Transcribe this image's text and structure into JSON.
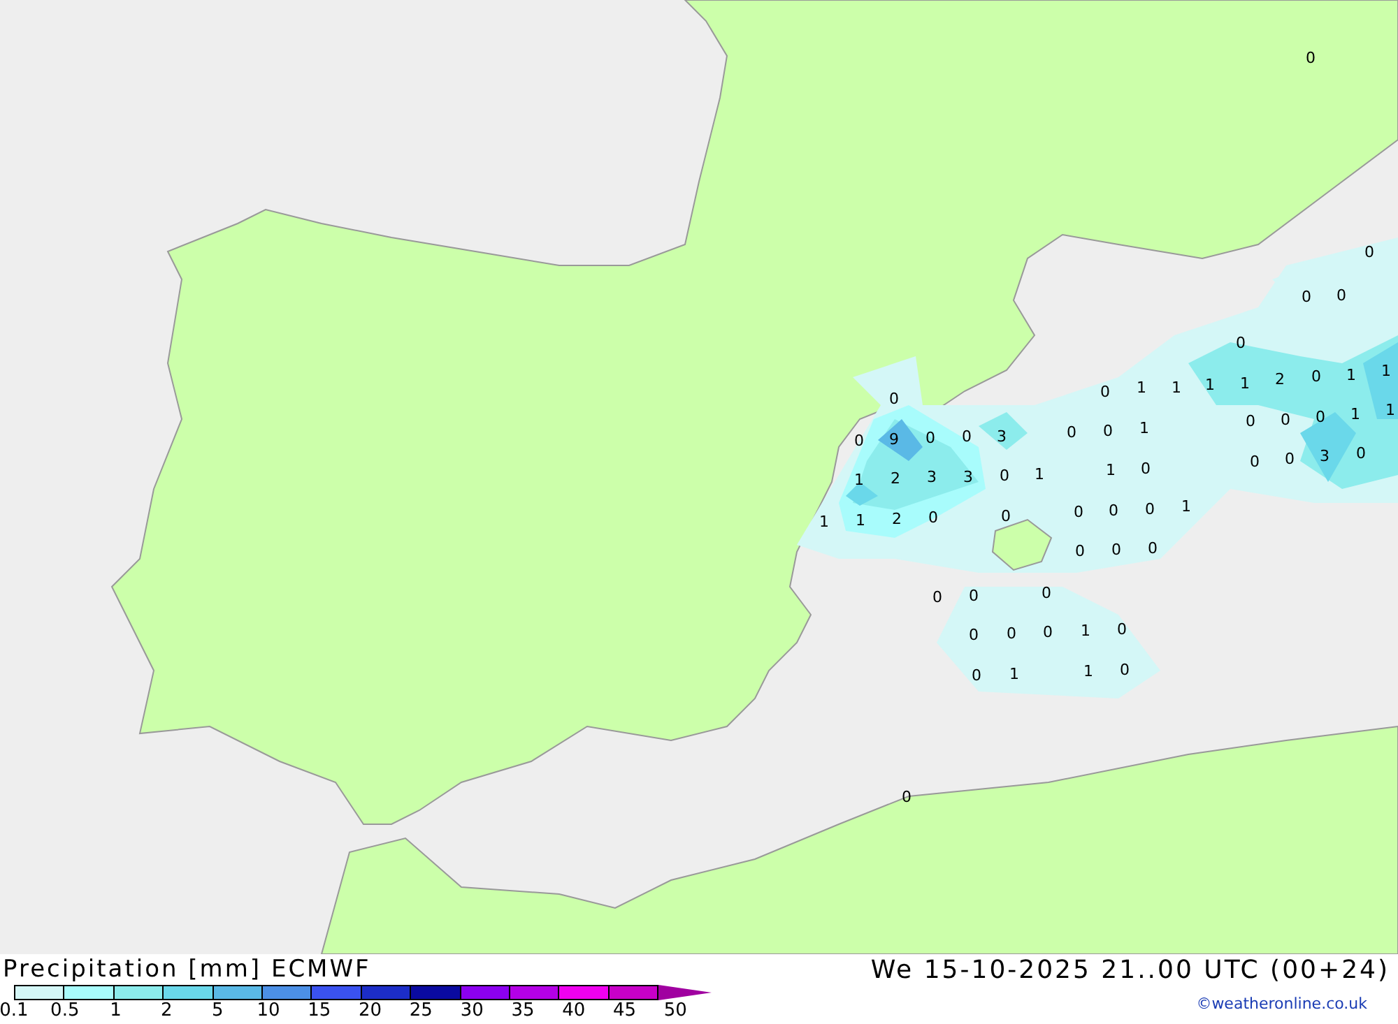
{
  "map_labels": [
    "0",
    "0",
    "0",
    "0",
    "0",
    "0",
    "1",
    "1",
    "1",
    "1",
    "2",
    "0",
    "1",
    "1",
    "0",
    "0",
    "9",
    "0",
    "0",
    "3",
    "0",
    "0",
    "1",
    "0",
    "0",
    "0",
    "1",
    "1",
    "1",
    "2",
    "3",
    "3",
    "0",
    "1",
    "1",
    "0",
    "0",
    "0",
    "3",
    "0",
    "1",
    "1",
    "2",
    "0",
    "0",
    "0",
    "0",
    "0",
    "1",
    "0",
    "0",
    "0",
    "0",
    "0",
    "0",
    "0",
    "0",
    "0",
    "1",
    "0",
    "0",
    "1",
    "1",
    "0",
    "0"
  ],
  "legend": {
    "title": "Precipitation [mm] ECMWF",
    "scale": [
      {
        "kind": "box",
        "color": "#d4f7f7"
      },
      {
        "kind": "box",
        "color": "#a8fcfc"
      },
      {
        "kind": "box",
        "color": "#8cecec"
      },
      {
        "kind": "box",
        "color": "#6ad8ea"
      },
      {
        "kind": "box",
        "color": "#5ab9e6"
      },
      {
        "kind": "box",
        "color": "#4c90e6"
      },
      {
        "kind": "box",
        "color": "#3a52f0"
      },
      {
        "kind": "box",
        "color": "#1c2dc8"
      },
      {
        "kind": "box",
        "color": "#0a0aa0"
      },
      {
        "kind": "box",
        "color": "#8c00f0"
      },
      {
        "kind": "box",
        "color": "#b400e6"
      },
      {
        "kind": "box",
        "color": "#f000f0"
      },
      {
        "kind": "box",
        "color": "#c800c8"
      },
      {
        "kind": "arrow",
        "color": "#a000a0"
      }
    ],
    "ticks": [
      "0.1",
      "0.5",
      "1",
      "2",
      "5",
      "10",
      "15",
      "20",
      "25",
      "30",
      "35",
      "40",
      "45",
      "50"
    ]
  },
  "timestamp": "We 15-10-2025 21..00 UTC (00+24)",
  "credit": "©weatheronline.co.uk"
}
